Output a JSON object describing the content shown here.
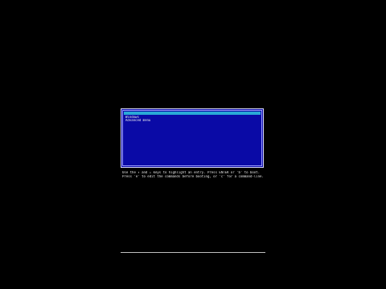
{
  "header": {
    "version_text": "",
    "corner_marker": ""
  },
  "menu": {
    "items": [
      {
        "label": "",
        "selected": true
      },
      {
        "label": "Windows",
        "selected": false
      },
      {
        "label": "Advanced menu",
        "selected": false
      }
    ]
  },
  "help": {
    "line1": "Use the ↑ and ↓ keys to highlight an entry. Press ENTER or 'b' to boot.",
    "line2": "Press 'e' to edit the commands before booting, or 'c' for a command-line."
  },
  "colors": {
    "screen_background": "#000000",
    "menu_background": "#0a0aa6",
    "menu_border": "#d8d8ff",
    "selection_highlight": "#29a9d6",
    "text": "#e8e8e8"
  }
}
